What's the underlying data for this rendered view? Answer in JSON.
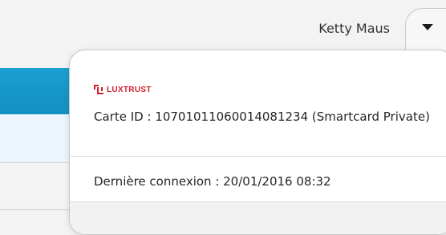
{
  "user": {
    "name": "Ketty Maus"
  },
  "menu_toggle": {
    "icon": "caret-down-icon"
  },
  "panel": {
    "logo_text": "LUXTRUST",
    "card_label": "Carte ID",
    "card_id": "10701011060014081234",
    "card_type": "Smartcard Private",
    "card_info": "Carte ID : 10701011060014081234 (Smartcard Private)",
    "last_login_label": "Dernière connexion",
    "last_login_value": "20/01/2016 08:32",
    "last_login": "Dernière connexion : 20/01/2016 08:32"
  },
  "colors": {
    "brand": "#d3202f",
    "accent_blue": "#1a9fd1"
  }
}
